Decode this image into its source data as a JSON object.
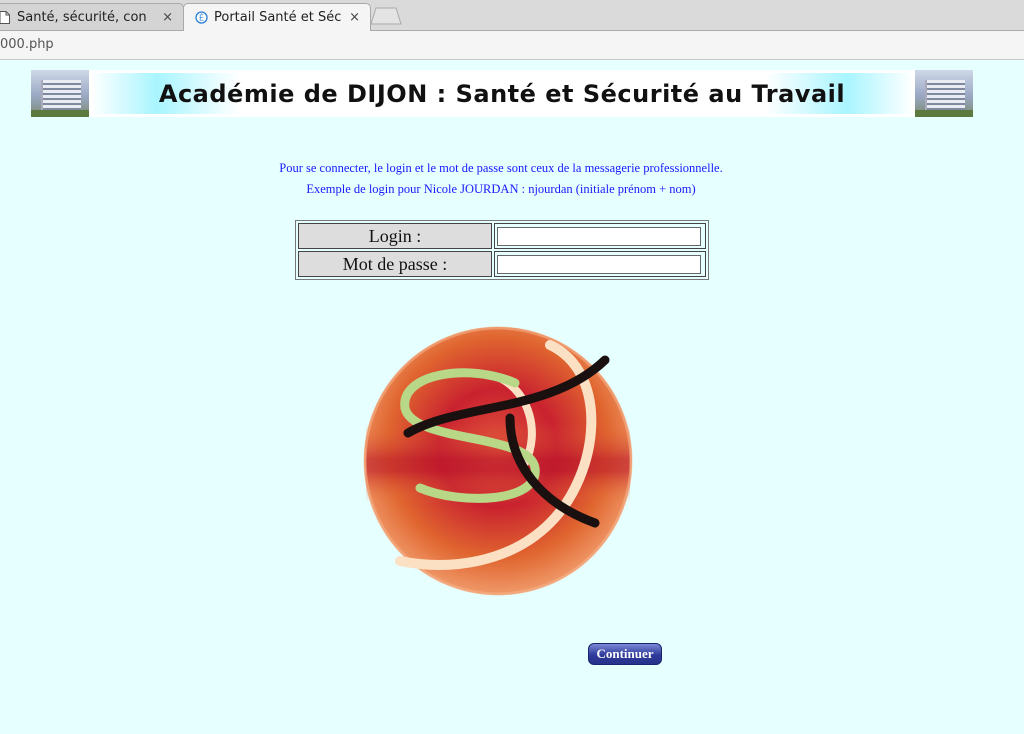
{
  "browser": {
    "tabs": [
      {
        "label": "Santé, sécurité, con",
        "active": false
      },
      {
        "label": "Portail Santé et Séc",
        "active": true
      }
    ],
    "close_glyph": "×",
    "url": "000.php"
  },
  "banner": {
    "title": "Académie de DIJON : Santé et Sécurité au Travail"
  },
  "info": {
    "line1": "Pour se connecter, le login et le mot de passe sont ceux de la messagerie professionnelle.",
    "line2": "Exemple de login pour Nicole JOURDAN : njourdan (initiale prénom + nom)"
  },
  "form": {
    "login_label": "Login :",
    "login_value": "",
    "password_label": "Mot de passe :",
    "password_value": "",
    "submit_label": "Continuer"
  },
  "icons": {
    "page_tab": "document-icon",
    "active_tab": "site-favicon",
    "logo": "sst-logo"
  }
}
